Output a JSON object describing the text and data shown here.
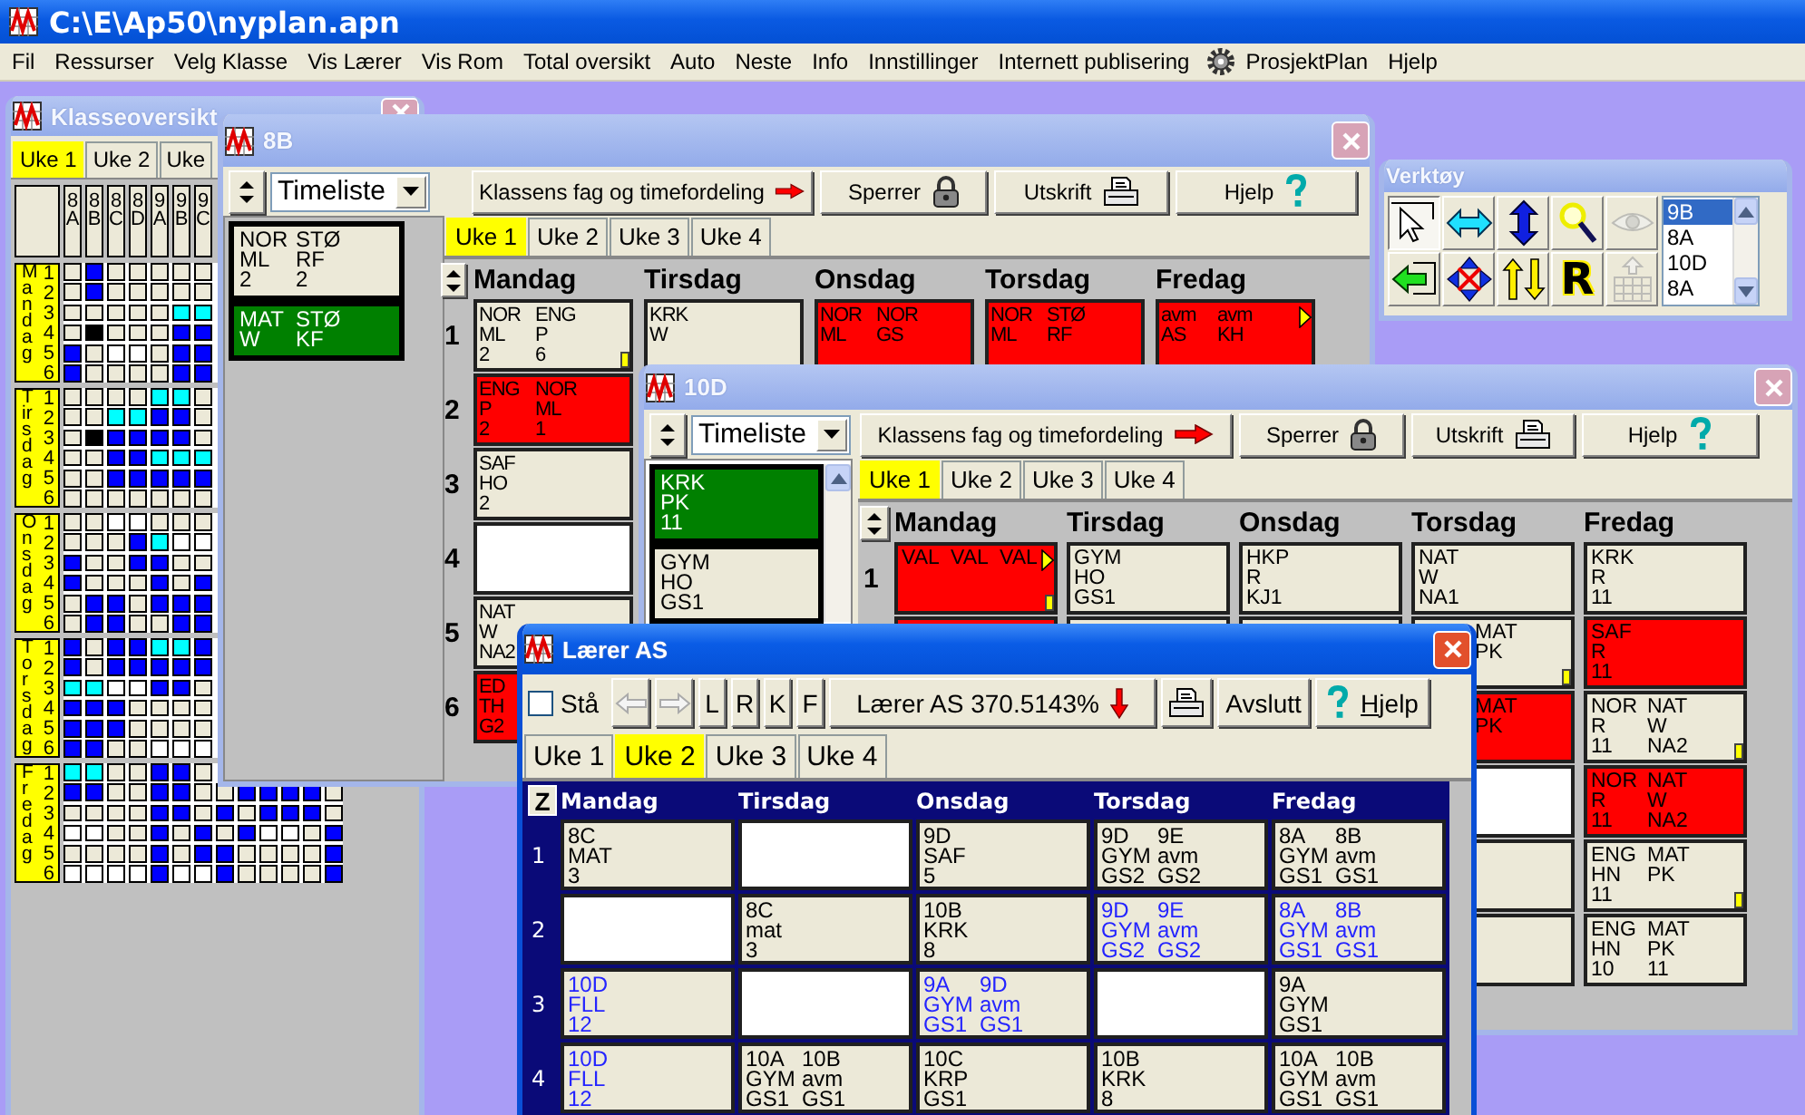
{
  "app": {
    "title": "C:\\E\\Ap50\\nyplan.apn"
  },
  "menu": [
    {
      "label": "Fil"
    },
    {
      "label": "Ressurser"
    },
    {
      "label": "Velg Klasse"
    },
    {
      "label": "Vis Lærer"
    },
    {
      "label": "Vis Rom"
    },
    {
      "label": "Total oversikt"
    },
    {
      "label": "Auto"
    },
    {
      "label": "Neste"
    },
    {
      "label": "Info"
    },
    {
      "label": "Innstillinger"
    },
    {
      "label": "Internett publisering"
    },
    {
      "label": "ProsjektPlan",
      "kind": "gear"
    },
    {
      "label": "Hjelp"
    }
  ],
  "class_overview": {
    "title": "Klasseoversikt",
    "kind": "document",
    "active": false,
    "closable": true,
    "tabs": [
      {
        "label": "Uke 1",
        "selected": true
      },
      {
        "label": "Uke 2",
        "selected": false
      },
      {
        "label": "Uke",
        "selected": false
      }
    ],
    "columns": [
      "8A",
      "8B",
      "8C",
      "8D",
      "9A",
      "9B",
      "9C"
    ],
    "days": [
      {
        "name": "Mandag",
        "periods": [
          {
            "number": "1",
            "cells": [
              {
                "color": "#ece9d8"
              },
              {
                "color": "#0000ff"
              },
              {
                "color": "#ece9d8"
              },
              {
                "color": "#ece9d8"
              },
              {
                "color": "#ece9d8"
              },
              {
                "color": "#ece9d8"
              },
              {
                "color": "#ece9d8"
              }
            ]
          },
          {
            "number": "2",
            "cells": [
              {
                "color": "#ece9d8"
              },
              {
                "color": "#0000ff"
              },
              {
                "color": "#ece9d8"
              },
              {
                "color": "#ece9d8"
              },
              {
                "color": "#ece9d8"
              },
              {
                "color": "#ece9d8"
              },
              {
                "color": "#ece9d8"
              }
            ]
          },
          {
            "number": "3",
            "cells": [
              {
                "color": "#ece9d8"
              },
              {
                "color": "#ece9d8"
              },
              {
                "color": "#ece9d8"
              },
              {
                "color": "#ece9d8"
              },
              {
                "color": "#ece9d8"
              },
              {
                "color": "#00ffff"
              },
              {
                "color": "#00ffff"
              }
            ]
          },
          {
            "number": "4",
            "cells": [
              {
                "color": "#ece9d8"
              },
              {
                "color": "#000000"
              },
              {
                "color": "#ece9d8"
              },
              {
                "color": "#ece9d8"
              },
              {
                "color": "#ece9d8"
              },
              {
                "color": "#0000ff"
              },
              {
                "color": "#0000ff"
              }
            ]
          },
          {
            "number": "5",
            "cells": [
              {
                "color": "#0000ff"
              },
              {
                "color": "#ece9d8"
              },
              {
                "color": "#ffffff"
              },
              {
                "color": "#ffffff"
              },
              {
                "color": "#ece9d8"
              },
              {
                "color": "#0000ff"
              },
              {
                "color": "#0000ff"
              }
            ]
          },
          {
            "number": "6",
            "cells": [
              {
                "color": "#0000ff"
              },
              {
                "color": "#ece9d8"
              },
              {
                "color": "#ece9d8"
              },
              {
                "color": "#ece9d8"
              },
              {
                "color": "#ece9d8"
              },
              {
                "color": "#0000ff"
              },
              {
                "color": "#0000ff"
              }
            ]
          }
        ]
      },
      {
        "name": "Tirsdag",
        "periods": [
          {
            "number": "1",
            "cells": [
              {
                "color": "#ece9d8"
              },
              {
                "color": "#ece9d8"
              },
              {
                "color": "#ece9d8"
              },
              {
                "color": "#ece9d8"
              },
              {
                "color": "#00ffff"
              },
              {
                "color": "#00ffff"
              },
              {
                "color": "#ece9d8"
              }
            ]
          },
          {
            "number": "2",
            "cells": [
              {
                "color": "#ece9d8"
              },
              {
                "color": "#ece9d8"
              },
              {
                "color": "#00ffff"
              },
              {
                "color": "#00ffff"
              },
              {
                "color": "#0000ff"
              },
              {
                "color": "#0000ff"
              },
              {
                "color": "#ece9d8"
              }
            ]
          },
          {
            "number": "3",
            "cells": [
              {
                "color": "#ece9d8"
              },
              {
                "color": "#000000"
              },
              {
                "color": "#0000ff"
              },
              {
                "color": "#0000ff"
              },
              {
                "color": "#0000ff"
              },
              {
                "color": "#0000ff"
              },
              {
                "color": "#ece9d8"
              }
            ]
          },
          {
            "number": "4",
            "cells": [
              {
                "color": "#ece9d8"
              },
              {
                "color": "#ece9d8"
              },
              {
                "color": "#0000ff"
              },
              {
                "color": "#0000ff"
              },
              {
                "color": "#00ffff"
              },
              {
                "color": "#00ffff"
              },
              {
                "color": "#00ffff"
              }
            ]
          },
          {
            "number": "5",
            "cells": [
              {
                "color": "#ece9d8"
              },
              {
                "color": "#ece9d8"
              },
              {
                "color": "#0000ff"
              },
              {
                "color": "#0000ff"
              },
              {
                "color": "#0000ff"
              },
              {
                "color": "#0000ff"
              },
              {
                "color": "#0000ff"
              }
            ]
          },
          {
            "number": "6",
            "cells": [
              {
                "color": "#ece9d8"
              },
              {
                "color": "#ece9d8"
              },
              {
                "color": "#ece9d8"
              },
              {
                "color": "#ece9d8"
              },
              {
                "color": "#ece9d8"
              },
              {
                "color": "#ece9d8"
              },
              {
                "color": "#ece9d8"
              }
            ]
          }
        ]
      },
      {
        "name": "Onsdag",
        "periods": [
          {
            "number": "1",
            "cells": [
              {
                "color": "#ece9d8"
              },
              {
                "color": "#ece9d8"
              },
              {
                "color": "#ffffff"
              },
              {
                "color": "#ffffff"
              },
              {
                "color": "#ece9d8"
              },
              {
                "color": "#ece9d8"
              },
              {
                "color": "#ece9d8"
              }
            ]
          },
          {
            "number": "2",
            "cells": [
              {
                "color": "#ece9d8"
              },
              {
                "color": "#ece9d8"
              },
              {
                "color": "#ece9d8"
              },
              {
                "color": "#0000ff"
              },
              {
                "color": "#00ffff"
              },
              {
                "color": "#ffffff"
              },
              {
                "color": "#ffffff"
              }
            ]
          },
          {
            "number": "3",
            "cells": [
              {
                "color": "#0000ff"
              },
              {
                "color": "#ece9d8"
              },
              {
                "color": "#ece9d8"
              },
              {
                "color": "#0000ff"
              },
              {
                "color": "#0000ff"
              },
              {
                "color": "#ece9d8"
              },
              {
                "color": "#ece9d8"
              }
            ]
          },
          {
            "number": "4",
            "cells": [
              {
                "color": "#0000ff"
              },
              {
                "color": "#ece9d8"
              },
              {
                "color": "#ece9d8"
              },
              {
                "color": "#ece9d8"
              },
              {
                "color": "#0000ff"
              },
              {
                "color": "#ece9d8"
              },
              {
                "color": "#0000ff"
              }
            ]
          },
          {
            "number": "5",
            "cells": [
              {
                "color": "#ece9d8"
              },
              {
                "color": "#0000ff"
              },
              {
                "color": "#0000ff"
              },
              {
                "color": "#ece9d8"
              },
              {
                "color": "#0000ff"
              },
              {
                "color": "#0000ff"
              },
              {
                "color": "#0000ff"
              }
            ]
          },
          {
            "number": "6",
            "cells": [
              {
                "color": "#ece9d8"
              },
              {
                "color": "#0000ff"
              },
              {
                "color": "#0000ff"
              },
              {
                "color": "#ece9d8"
              },
              {
                "color": "#ece9d8"
              },
              {
                "color": "#0000ff"
              },
              {
                "color": "#0000ff"
              }
            ]
          }
        ]
      },
      {
        "name": "Torsdag",
        "periods": [
          {
            "number": "1",
            "cells": [
              {
                "color": "#0000ff"
              },
              {
                "color": "#ece9d8"
              },
              {
                "color": "#0000ff"
              },
              {
                "color": "#0000ff"
              },
              {
                "color": "#00ffff"
              },
              {
                "color": "#00ffff"
              },
              {
                "color": "#0000ff"
              }
            ]
          },
          {
            "number": "2",
            "cells": [
              {
                "color": "#0000ff"
              },
              {
                "color": "#ece9d8"
              },
              {
                "color": "#0000ff"
              },
              {
                "color": "#0000ff"
              },
              {
                "color": "#0000ff"
              },
              {
                "color": "#0000ff"
              },
              {
                "color": "#0000ff"
              }
            ]
          },
          {
            "number": "3",
            "cells": [
              {
                "color": "#00ffff"
              },
              {
                "color": "#00ffff"
              },
              {
                "color": "#ffffff"
              },
              {
                "color": "#ffffff"
              },
              {
                "color": "#0000ff"
              },
              {
                "color": "#0000ff"
              },
              {
                "color": "#ece9d8"
              }
            ]
          },
          {
            "number": "4",
            "cells": [
              {
                "color": "#0000ff"
              },
              {
                "color": "#0000ff"
              },
              {
                "color": "#0000ff"
              },
              {
                "color": "#ece9d8"
              },
              {
                "color": "#ece9d8"
              },
              {
                "color": "#ece9d8"
              },
              {
                "color": "#ece9d8"
              }
            ]
          },
          {
            "number": "5",
            "cells": [
              {
                "color": "#0000ff"
              },
              {
                "color": "#0000ff"
              },
              {
                "color": "#0000ff"
              },
              {
                "color": "#ece9d8"
              },
              {
                "color": "#ece9d8"
              },
              {
                "color": "#ece9d8"
              },
              {
                "color": "#ece9d8"
              }
            ]
          },
          {
            "number": "6",
            "cells": [
              {
                "color": "#0000ff"
              },
              {
                "color": "#0000ff"
              },
              {
                "color": "#ece9d8"
              },
              {
                "color": "#ece9d8"
              },
              {
                "color": "#ffffff"
              },
              {
                "color": "#ffffff"
              },
              {
                "color": "#ffffff"
              }
            ]
          }
        ]
      },
      {
        "name": "Fredag",
        "periods": [
          {
            "number": "1",
            "cells": [
              {
                "color": "#00ffff"
              },
              {
                "color": "#00ffff"
              },
              {
                "color": "#ece9d8"
              },
              {
                "color": "#ece9d8"
              },
              {
                "color": "#0000ff"
              },
              {
                "color": "#0000ff"
              },
              {
                "color": "#ece9d8"
              }
            ]
          },
          {
            "number": "2",
            "cells": [
              {
                "color": "#0000ff"
              },
              {
                "color": "#0000ff"
              },
              {
                "color": "#ece9d8"
              },
              {
                "color": "#ece9d8"
              },
              {
                "color": "#0000ff"
              },
              {
                "color": "#0000ff"
              },
              {
                "color": "#ece9d8"
              },
              {
                "color": "#ece9d8"
              },
              {
                "color": "#0000ff"
              },
              {
                "color": "#0000ff"
              },
              {
                "color": "#0000ff"
              },
              {
                "color": "#0000ff"
              },
              {
                "color": "#ece9d8"
              }
            ]
          },
          {
            "number": "3",
            "cells": [
              {
                "color": "#ece9d8"
              },
              {
                "color": "#ece9d8"
              },
              {
                "color": "#ece9d8"
              },
              {
                "color": "#ece9d8"
              },
              {
                "color": "#0000ff"
              },
              {
                "color": "#0000ff"
              },
              {
                "color": "#ece9d8"
              },
              {
                "color": "#0000ff"
              },
              {
                "color": "#ece9d8"
              },
              {
                "color": "#0000ff"
              },
              {
                "color": "#0000ff"
              },
              {
                "color": "#0000ff"
              },
              {
                "color": "#ece9d8"
              }
            ]
          },
          {
            "number": "4",
            "cells": [
              {
                "color": "#ffffff"
              },
              {
                "color": "#ffffff"
              },
              {
                "color": "#ece9d8"
              },
              {
                "color": "#ece9d8"
              },
              {
                "color": "#0000ff"
              },
              {
                "color": "#ece9d8"
              },
              {
                "color": "#0000ff"
              },
              {
                "color": "#ece9d8"
              },
              {
                "color": "#0000ff"
              },
              {
                "color": "#ffffff"
              },
              {
                "color": "#ffffff"
              },
              {
                "color": "#ece9d8"
              },
              {
                "color": "#0000ff"
              }
            ]
          },
          {
            "number": "5",
            "cells": [
              {
                "color": "#ece9d8"
              },
              {
                "color": "#ece9d8"
              },
              {
                "color": "#ece9d8"
              },
              {
                "color": "#ece9d8"
              },
              {
                "color": "#0000ff"
              },
              {
                "color": "#ece9d8"
              },
              {
                "color": "#0000ff"
              },
              {
                "color": "#0000ff"
              },
              {
                "color": "#ece9d8"
              },
              {
                "color": "#ece9d8"
              },
              {
                "color": "#ece9d8"
              },
              {
                "color": "#ece9d8"
              },
              {
                "color": "#0000ff"
              }
            ]
          },
          {
            "number": "6",
            "cells": [
              {
                "color": "#ffffff"
              },
              {
                "color": "#ffffff"
              },
              {
                "color": "#ffffff"
              },
              {
                "color": "#ffffff"
              },
              {
                "color": "#0000ff"
              },
              {
                "color": "#ffffff"
              },
              {
                "color": "#ffffff"
              },
              {
                "color": "#0000ff"
              },
              {
                "color": "#ece9d8"
              },
              {
                "color": "#ece9d8"
              },
              {
                "color": "#ece9d8"
              },
              {
                "color": "#ece9d8"
              },
              {
                "color": "#0000ff"
              }
            ]
          }
        ]
      }
    ]
  },
  "class_8b": {
    "title": "8B",
    "kind": "document",
    "active": false,
    "closable": true,
    "view": "Timeliste",
    "buttons": [
      {
        "label": "Klassens fag og timefordeling",
        "kind": "arrow"
      },
      {
        "label": "Sperrer",
        "kind": "lock"
      },
      {
        "label": "Utskrift",
        "kind": "print"
      },
      {
        "label": "Hjelp",
        "kind": "help"
      }
    ],
    "pending": [
      {
        "kind": "normal",
        "lines": [
          [
            "NOR",
            "STØ"
          ],
          [
            "ML",
            "RF"
          ],
          [
            "2",
            "2"
          ]
        ]
      },
      {
        "kind": "green",
        "lines": [
          [
            "MAT",
            "STØ"
          ],
          [
            "W",
            "KF"
          ]
        ]
      }
    ],
    "tabs": [
      {
        "label": "Uke 1",
        "selected": true
      },
      {
        "label": "Uke 2",
        "selected": false
      },
      {
        "label": "Uke 3",
        "selected": false
      },
      {
        "label": "Uke 4",
        "selected": false
      }
    ],
    "days": [
      "Mandag",
      "Tirsdag",
      "Onsdag",
      "Torsdag",
      "Fredag"
    ],
    "rows": [
      {
        "number": "1",
        "cells": [
          {
            "kind": "normal",
            "lines": [
              [
                "NOR",
                "ENG"
              ],
              [
                "ML",
                "P"
              ],
              [
                "2",
                "6"
              ]
            ],
            "flag": true
          },
          {
            "kind": "normal",
            "lines": [
              [
                "KRK"
              ],
              [
                "W"
              ]
            ]
          },
          {
            "kind": "red",
            "lines": [
              [
                "NOR",
                "NOR"
              ],
              [
                "ML",
                "GS"
              ]
            ]
          },
          {
            "kind": "red",
            "lines": [
              [
                "NOR",
                "STØ"
              ],
              [
                "ML",
                "RF"
              ]
            ]
          },
          {
            "kind": "red",
            "lines": [
              [
                "avm",
                "avm"
              ],
              [
                "AS",
                "KH"
              ]
            ],
            "arrow": true
          }
        ]
      },
      {
        "number": "2",
        "cells": [
          {
            "kind": "red",
            "lines": [
              [
                "ENG",
                "NOR"
              ],
              [
                "P",
                "ML"
              ],
              [
                "2",
                "1"
              ]
            ]
          }
        ]
      },
      {
        "number": "3",
        "cells": [
          {
            "kind": "normal",
            "lines": [
              [
                "SAF"
              ],
              [
                "HO"
              ],
              [
                "2"
              ]
            ]
          }
        ]
      },
      {
        "number": "4",
        "cells": [
          {
            "kind": "empty"
          }
        ]
      },
      {
        "number": "5",
        "cells": [
          {
            "kind": "normal",
            "lines": [
              [
                "NAT"
              ],
              [
                "W"
              ],
              [
                "NA2"
              ]
            ]
          }
        ]
      },
      {
        "number": "6",
        "cells": [
          {
            "kind": "red",
            "lines": [
              [
                "ED"
              ],
              [
                "TH"
              ],
              [
                "G2"
              ]
            ]
          }
        ]
      }
    ]
  },
  "tools": {
    "title": "Verktøy",
    "kind": "tool",
    "active": false,
    "tools": [
      {
        "kind": "pointer",
        "selected": true,
        "disabled": false
      },
      {
        "kind": "swap_horizontal",
        "selected": false,
        "disabled": false
      },
      {
        "kind": "swap_vertical",
        "selected": false,
        "disabled": false
      },
      {
        "kind": "magnifier",
        "selected": false,
        "disabled": false
      },
      {
        "kind": "eye",
        "selected": false,
        "disabled": true
      },
      {
        "kind": "arrow_left",
        "selected": false,
        "disabled": false
      },
      {
        "kind": "move",
        "selected": false,
        "disabled": false
      },
      {
        "kind": "up_down",
        "selected": false,
        "disabled": false
      },
      {
        "kind": "letter",
        "label": "R",
        "selected": false,
        "disabled": false
      },
      {
        "kind": "grid_up",
        "selected": false,
        "disabled": true
      }
    ],
    "classes": [
      {
        "label": "9B",
        "selected": true
      },
      {
        "label": "8A",
        "selected": false
      },
      {
        "label": "10D",
        "selected": false
      },
      {
        "label": "8A",
        "selected": false
      }
    ]
  },
  "class_10d": {
    "title": "10D",
    "kind": "document",
    "active": false,
    "closable": true,
    "view": "Timeliste",
    "buttons": [
      {
        "label": "Klassens fag og timefordeling",
        "kind": "arrow"
      },
      {
        "label": "Sperrer",
        "kind": "lock"
      },
      {
        "label": "Utskrift",
        "kind": "print"
      },
      {
        "label": "Hjelp",
        "kind": "help"
      }
    ],
    "pending": [
      {
        "kind": "green",
        "lines": [
          [
            "KRK"
          ],
          [
            "PK"
          ],
          [
            "11"
          ]
        ]
      },
      {
        "kind": "normal",
        "lines": [
          [
            "GYM"
          ],
          [
            "HO"
          ],
          [
            "GS1"
          ]
        ]
      }
    ],
    "tabs": [
      {
        "label": "Uke 1",
        "selected": true
      },
      {
        "label": "Uke 2",
        "selected": false
      },
      {
        "label": "Uke 3",
        "selected": false
      },
      {
        "label": "Uke 4",
        "selected": false
      }
    ],
    "days": [
      "Mandag",
      "Tirsdag",
      "Onsdag",
      "Torsdag",
      "Fredag"
    ],
    "rows": [
      {
        "number": "1",
        "cells": [
          {
            "kind": "red",
            "lines": [
              [
                "VAL",
                "VAL",
                "VAL"
              ]
            ],
            "arrow": true,
            "flag": true
          },
          {
            "kind": "normal",
            "lines": [
              [
                "GYM"
              ],
              [
                "HO"
              ],
              [
                "GS1"
              ]
            ]
          },
          {
            "kind": "normal",
            "lines": [
              [
                "HKP"
              ],
              [
                "R"
              ],
              [
                "KJ1"
              ]
            ]
          },
          {
            "kind": "normal",
            "lines": [
              [
                "NAT"
              ],
              [
                "W"
              ],
              [
                "NA1"
              ]
            ]
          },
          {
            "kind": "normal",
            "lines": [
              [
                "KRK"
              ],
              [
                "R"
              ],
              [
                "11"
              ]
            ]
          }
        ]
      },
      {
        "cells": [
          {
            "kind": "red"
          },
          {
            "kind": "normal"
          },
          {
            "kind": "normal"
          },
          {
            "kind": "normal",
            "lines": [
              [
                "MAT"
              ],
              [
                "PK"
              ]
            ],
            "indent": true,
            "flag": true
          },
          {
            "kind": "red",
            "lines": [
              [
                "SAF"
              ],
              [
                "R"
              ],
              [
                "11"
              ]
            ]
          }
        ]
      },
      {
        "cells": [
          null,
          null,
          null,
          {
            "kind": "red",
            "lines": [
              [
                "MAT"
              ],
              [
                "PK"
              ]
            ],
            "indent": true
          },
          {
            "kind": "normal",
            "lines": [
              [
                "NOR",
                "NAT"
              ],
              [
                "R",
                "W"
              ],
              [
                "11",
                "NA2"
              ]
            ],
            "flag": true
          }
        ]
      },
      {
        "cells": [
          null,
          null,
          null,
          {
            "kind": "empty"
          },
          {
            "kind": "red",
            "lines": [
              [
                "NOR",
                "NAT"
              ],
              [
                "R",
                "W"
              ],
              [
                "11",
                "NA2"
              ]
            ]
          }
        ]
      },
      {
        "cells": [
          null,
          null,
          null,
          {
            "kind": "normal"
          },
          {
            "kind": "normal",
            "lines": [
              [
                "ENG",
                "MAT"
              ],
              [
                "HN",
                "PK"
              ],
              [
                "11"
              ]
            ],
            "flag": true
          }
        ]
      },
      {
        "cells": [
          null,
          null,
          null,
          {
            "kind": "normal"
          },
          {
            "kind": "normal",
            "lines": [
              [
                "ENG",
                "MAT"
              ],
              [
                "HN",
                "PK"
              ],
              [
                "10",
                "11"
              ]
            ]
          }
        ]
      }
    ]
  },
  "teacher": {
    "title": "Lærer AS",
    "kind": "document",
    "active": true,
    "closable": true,
    "stand": {
      "label": "Stå",
      "checked": false
    },
    "nav": [
      {
        "kind": "left",
        "disabled": true
      },
      {
        "kind": "right",
        "disabled": true
      }
    ],
    "filters": [
      "L",
      "R",
      "K",
      "F"
    ],
    "summary": {
      "label": "Lærer AS 370.5143%",
      "kind": "arrow_down"
    },
    "buttons": [
      {
        "kind": "print"
      },
      {
        "label": "Avslutt",
        "kind": "plain"
      },
      {
        "label": "Hjelp",
        "kind": "help",
        "mnemonic": true
      }
    ],
    "tabs": [
      {
        "label": "Uke 1",
        "selected": false
      },
      {
        "label": "Uke 2",
        "selected": true
      },
      {
        "label": "Uke 3",
        "selected": false
      },
      {
        "label": "Uke 4",
        "selected": false
      }
    ],
    "corner": "Z",
    "days": [
      "Mandag",
      "Tirsdag",
      "Onsdag",
      "Torsdag",
      "Fredag"
    ],
    "rows": [
      {
        "number": "1",
        "cells": [
          {
            "kind": "normal",
            "lines": [
              [
                "8C"
              ],
              [
                "MAT"
              ],
              [
                "3"
              ]
            ]
          },
          {
            "kind": "empty"
          },
          {
            "kind": "normal",
            "lines": [
              [
                "9D"
              ],
              [
                "SAF"
              ],
              [
                "5"
              ]
            ]
          },
          {
            "kind": "normal",
            "lines": [
              [
                "9D",
                "9E"
              ],
              [
                "GYM",
                "avm"
              ],
              [
                "GS2",
                "GS2"
              ]
            ]
          },
          {
            "kind": "normal",
            "lines": [
              [
                "8A",
                "8B"
              ],
              [
                "GYM",
                "avm"
              ],
              [
                "GS1",
                "GS1"
              ]
            ]
          }
        ]
      },
      {
        "number": "2",
        "cells": [
          {
            "kind": "empty"
          },
          {
            "kind": "normal",
            "lines": [
              [
                "8C"
              ],
              [
                "mat"
              ],
              [
                "3"
              ]
            ]
          },
          {
            "kind": "normal",
            "lines": [
              [
                "10B"
              ],
              [
                "KRK"
              ],
              [
                "8"
              ]
            ]
          },
          {
            "kind": "tinted",
            "lines": [
              [
                "9D",
                "9E"
              ],
              [
                "GYM",
                "avm"
              ],
              [
                "GS2",
                "GS2"
              ]
            ]
          },
          {
            "kind": "tinted",
            "lines": [
              [
                "8A",
                "8B"
              ],
              [
                "GYM",
                "avm"
              ],
              [
                "GS1",
                "GS1"
              ]
            ]
          }
        ]
      },
      {
        "number": "3",
        "cells": [
          {
            "kind": "tinted",
            "lines": [
              [
                "10D"
              ],
              [
                "FLL"
              ],
              [
                "12"
              ]
            ]
          },
          {
            "kind": "empty"
          },
          {
            "kind": "tinted",
            "lines": [
              [
                "9A",
                "9D"
              ],
              [
                "GYM",
                "avm"
              ],
              [
                "GS1",
                "GS1"
              ]
            ]
          },
          {
            "kind": "empty"
          },
          {
            "kind": "normal",
            "lines": [
              [
                "9A"
              ],
              [
                "GYM"
              ],
              [
                "GS1"
              ]
            ]
          }
        ]
      },
      {
        "number": "4",
        "cells": [
          {
            "kind": "tinted",
            "lines": [
              [
                "10D"
              ],
              [
                "FLL"
              ],
              [
                "12"
              ]
            ]
          },
          {
            "kind": "normal",
            "lines": [
              [
                "10A",
                "10B"
              ],
              [
                "GYM",
                "avm"
              ],
              [
                "GS1",
                "GS1"
              ]
            ]
          },
          {
            "kind": "normal",
            "lines": [
              [
                "10C"
              ],
              [
                "KRP"
              ],
              [
                "GS1"
              ]
            ]
          },
          {
            "kind": "normal",
            "lines": [
              [
                "10B"
              ],
              [
                "KRK"
              ],
              [
                "8"
              ]
            ]
          },
          {
            "kind": "normal",
            "lines": [
              [
                "10A",
                "10B"
              ],
              [
                "GYM",
                "avm"
              ],
              [
                "GS1",
                "GS1"
              ]
            ]
          }
        ]
      }
    ]
  }
}
